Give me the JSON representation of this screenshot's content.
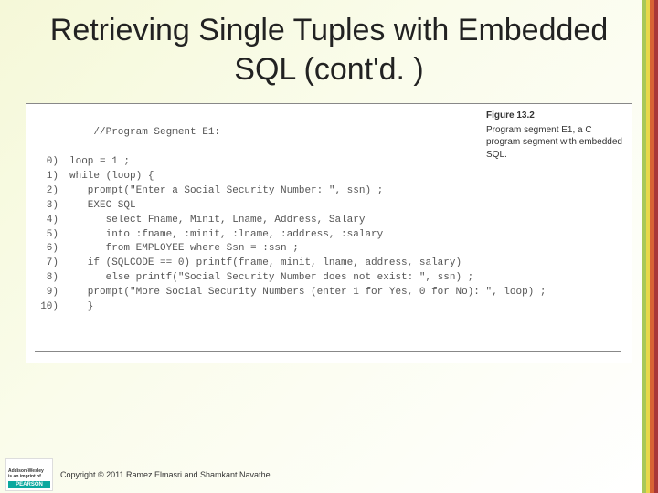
{
  "title": "Retrieving Single Tuples with Embedded SQL (cont'd. )",
  "figure": {
    "label": "Figure 13.2",
    "caption": "Program segment E1, a C program segment with embedded SQL."
  },
  "code": {
    "comment": "//Program Segment E1:",
    "lines": [
      {
        "n": "0)",
        "text": "loop = 1 ;"
      },
      {
        "n": "1)",
        "text": "while (loop) {"
      },
      {
        "n": "2)",
        "text": "   prompt(\"Enter a Social Security Number: \", ssn) ;"
      },
      {
        "n": "3)",
        "text": "   EXEC SQL"
      },
      {
        "n": "4)",
        "text": "      select Fname, Minit, Lname, Address, Salary"
      },
      {
        "n": "5)",
        "text": "      into :fname, :minit, :lname, :address, :salary"
      },
      {
        "n": "6)",
        "text": "      from EMPLOYEE where Ssn = :ssn ;"
      },
      {
        "n": "7)",
        "text": "   if (SQLCODE == 0) printf(fname, minit, lname, address, salary)"
      },
      {
        "n": "8)",
        "text": "      else printf(\"Social Security Number does not exist: \", ssn) ;"
      },
      {
        "n": "9)",
        "text": "   prompt(\"More Social Security Numbers (enter 1 for Yes, 0 for No): \", loop) ;"
      },
      {
        "n": "10)",
        "text": "   }"
      }
    ]
  },
  "publisher": {
    "imprint_line1": "Addison-Wesley",
    "imprint_line2": "is an imprint of",
    "brand": "PEARSON"
  },
  "copyright": "Copyright © 2011 Ramez Elmasri and Shamkant Navathe"
}
